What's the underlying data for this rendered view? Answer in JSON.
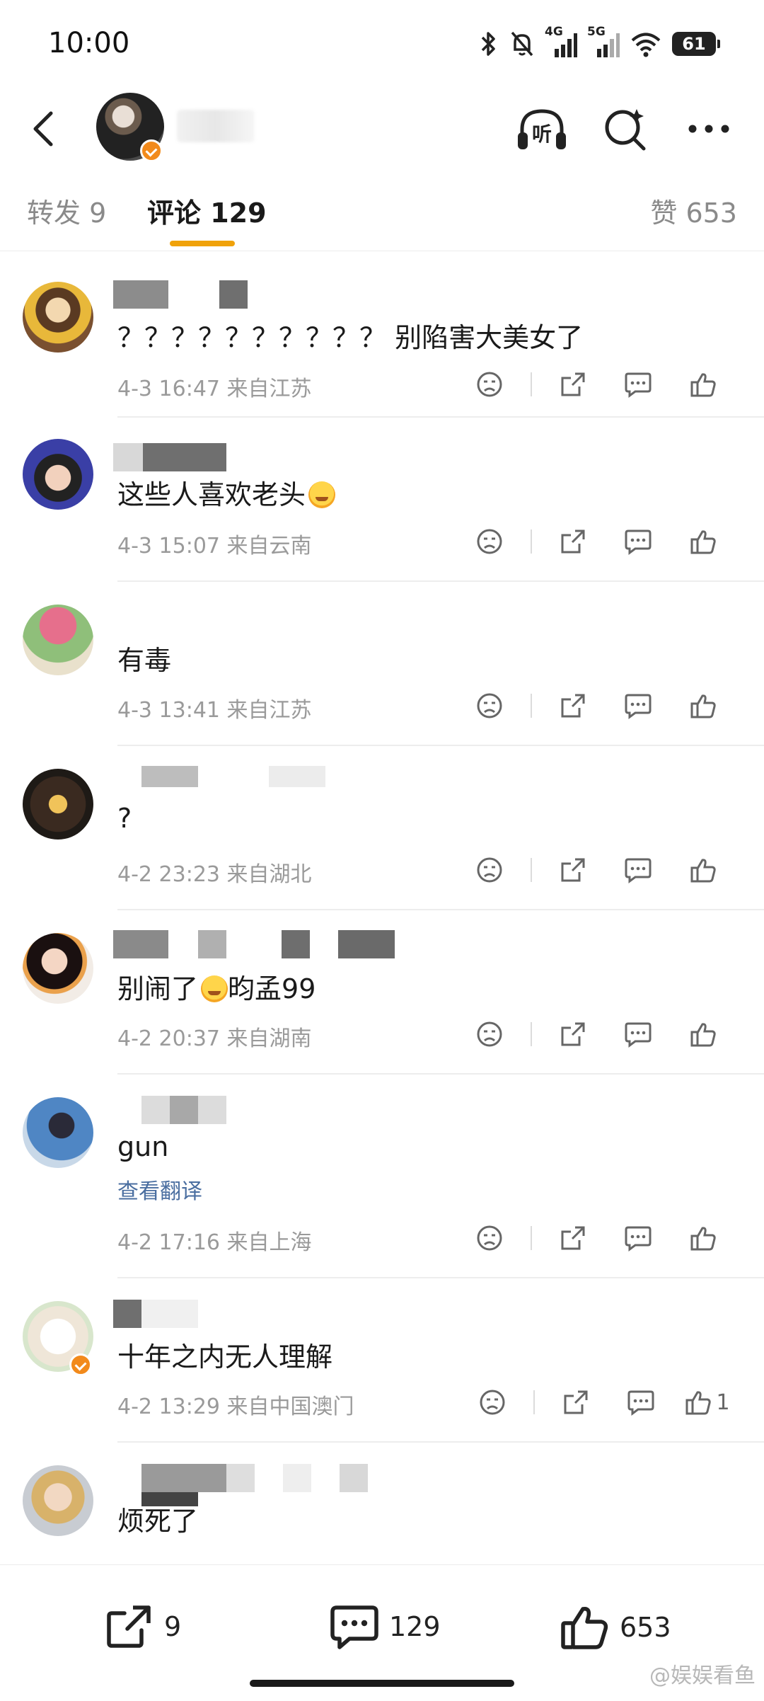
{
  "status_bar": {
    "time": "10:00",
    "network_1": "4G",
    "network_2": "5G",
    "battery": "61"
  },
  "header": {
    "listen_label": "听"
  },
  "tabs": {
    "repost": "转发 9",
    "comments": "评论 129",
    "likes": "赞 653"
  },
  "comments": [
    {
      "text": "？？？？？？？？？？ 别陷害大美女了",
      "time": "4-3 16:47",
      "location": "来自江苏",
      "likes": ""
    },
    {
      "text": "这些人喜欢老头",
      "time": "4-3 15:07",
      "location": "来自云南",
      "likes": ""
    },
    {
      "text": "有毒",
      "time": "4-3 13:41",
      "location": "来自江苏",
      "likes": ""
    },
    {
      "text": "?",
      "time": "4-2 23:23",
      "location": "来自湖北",
      "likes": ""
    },
    {
      "text": "别闹了",
      "text_suffix": "昀孟99",
      "time": "4-2 20:37",
      "location": "来自湖南",
      "likes": ""
    },
    {
      "text": "gun",
      "translate": "查看翻译",
      "time": "4-2 17:16",
      "location": "来自上海",
      "likes": ""
    },
    {
      "text": "十年之内无人理解",
      "time": "4-2 13:29",
      "location": "来自中国澳门",
      "likes": "1"
    },
    {
      "text": "烦死了"
    }
  ],
  "bottom_bar": {
    "repost_count": "9",
    "comment_count": "129",
    "like_count": "653"
  },
  "watermark": "@娱娱看鱼"
}
